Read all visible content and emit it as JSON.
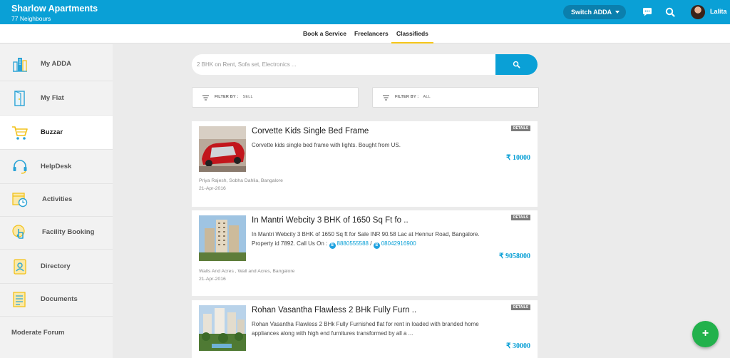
{
  "header": {
    "title": "Sharlow Apartments",
    "subtitle": "77 Neighbours",
    "switch_label": "Switch ADDA",
    "user_name": "Lalita"
  },
  "subnav": {
    "tabs": [
      {
        "label": "Book a Service"
      },
      {
        "label": "Freelancers"
      },
      {
        "label": "Classifieds",
        "active": true
      }
    ]
  },
  "sidebar": {
    "items": [
      {
        "label": "My ADDA",
        "icon": "building-icon"
      },
      {
        "label": "My Flat",
        "icon": "door-icon"
      },
      {
        "label": "Buzzar",
        "icon": "cart-icon",
        "active": true
      },
      {
        "label": "HelpDesk",
        "icon": "headset-icon"
      },
      {
        "label": "Activities",
        "icon": "calendar-clock-icon"
      },
      {
        "label": "Facility Booking",
        "icon": "hand-pointer-icon"
      },
      {
        "label": "Directory",
        "icon": "contact-book-icon"
      },
      {
        "label": "Documents",
        "icon": "document-icon"
      }
    ],
    "forum_label": "Moderate Forum"
  },
  "search": {
    "placeholder": "2 BHK on Rent, Sofa set, Electronics ..."
  },
  "filters": [
    {
      "label": "FILTER BY :",
      "value": "SELL"
    },
    {
      "label": "FILTER BY :",
      "value": "ALL"
    }
  ],
  "listings": [
    {
      "title": "Corvette Kids Single Bed Frame",
      "description": "Corvette kids single bed frame with lights. Bought from US.",
      "price": "₹ 10000",
      "details_label": "DETAILS",
      "seller": "Priya Rajesh, Sobha Dahlia, Bangalore",
      "date": "21-Apr-2016"
    },
    {
      "title": "In Mantri Webcity 3 BHK of 1650 Sq Ft fo ..",
      "description_lead": "In Mantri Webcity 3 BHK of 1650 Sq ft for Sale INR 90.58 Lac at Hennur Road, Bangalore. Property id 7892. Call Us On :",
      "phone1": "8880555588",
      "separator": "/",
      "phone2": "08042916900",
      "price": "₹ 9058000",
      "details_label": "DETAILS",
      "seller": "Walls And Acres , Wall and Acres, Bangalore",
      "date": "21-Apr-2016"
    },
    {
      "title": "Rohan Vasantha Flawless 2 BHk Fully Furn ..",
      "description": "Rohan Vasantha Flawless 2 BHk Fully Furnished flat for rent in loaded with branded home appliances along with high end furnitures transformed by all a ...",
      "price": "₹ 30000",
      "details_label": "DETAILS"
    }
  ],
  "fab_label": "+",
  "colors": {
    "brand": "#0aa0d6",
    "accent_tab": "#f5c518",
    "fab": "#22b14c",
    "icon_blue": "#29a3d6",
    "icon_yellow": "#f2c21b"
  }
}
